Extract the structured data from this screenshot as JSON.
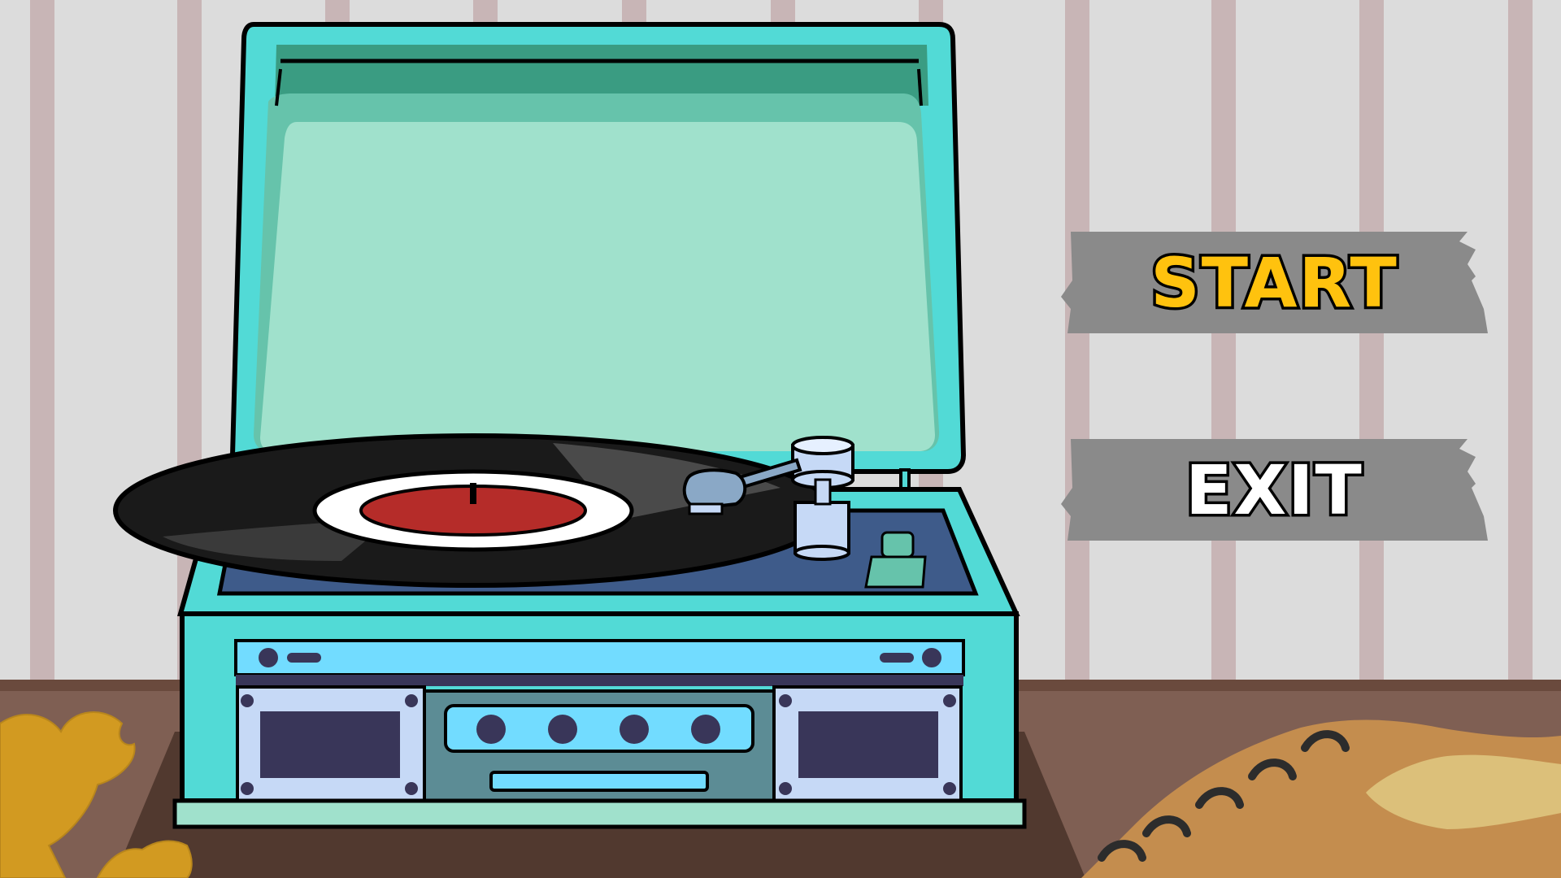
{
  "menu": {
    "start_label": "START",
    "exit_label": "EXIT"
  },
  "colors": {
    "wall": "#dcdcdc",
    "wall_stripe": "#c8b5b6",
    "table": "#7f5f53",
    "table_edge": "#6a4a3d",
    "player_body": "#52dad6",
    "lid_inner": "#a0e1cc",
    "deck": "#3e5b8a",
    "panel": "#72dcff",
    "speaker": "#c6d9f6",
    "speaker_grille": "#393659",
    "record": "#1a1a1a",
    "label_red": "#b52c29",
    "button_bg": "#8a8a8a",
    "start_text": "#ffc20e",
    "exit_text": "#ffffff",
    "notebook": "#c48d4e",
    "leaf": "#d29a21"
  },
  "icons": [
    "record-player-icon",
    "vinyl-record-icon",
    "tonearm-icon",
    "notebook-icon",
    "leaf-icon"
  ]
}
